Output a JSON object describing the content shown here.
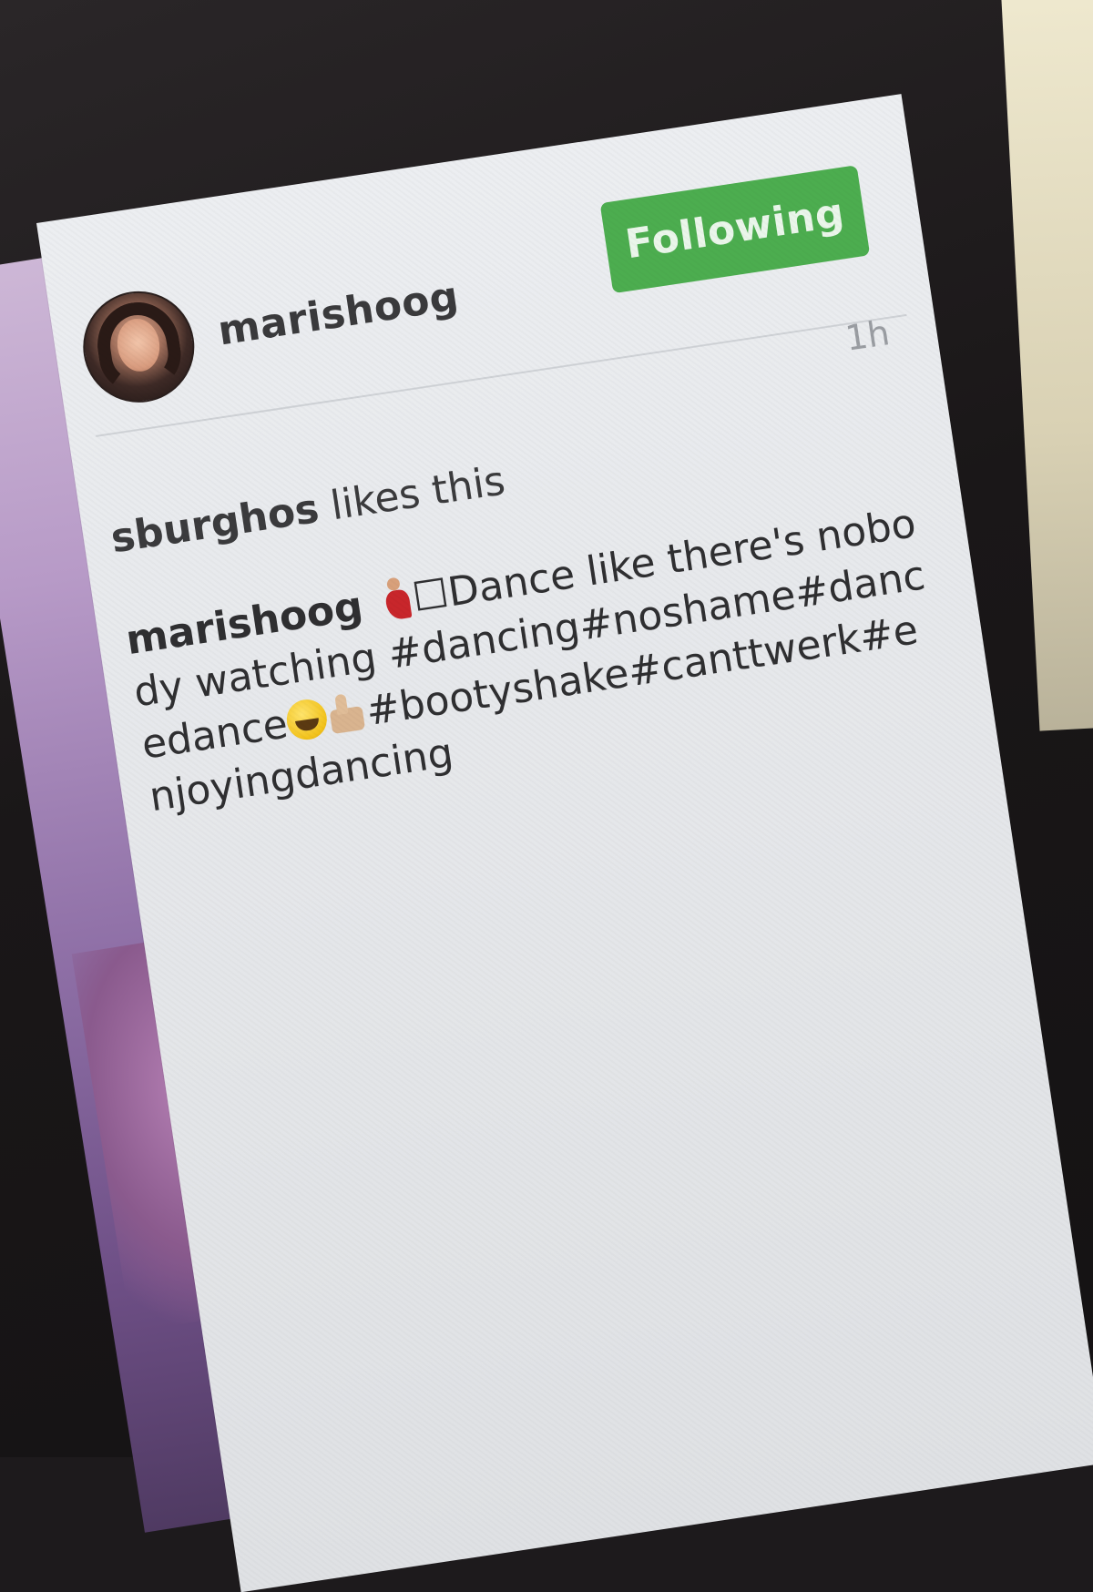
{
  "post": {
    "username": "marishoog",
    "follow_button_label": "Following",
    "timestamp": "1h",
    "likes": {
      "liker": "sburghos",
      "suffix": " likes this"
    },
    "caption": {
      "author": "marishoog",
      "text_part1": "Dance like there's nobody watching #dancing#noshame#dancedance",
      "text_part2": "#bootyshake#canttwerk#enjoyingdancing",
      "box_glyph": "☐"
    }
  },
  "icons": {
    "avatar": "profile-photo",
    "dancer": "dancer-emoji",
    "smile": "grinning-face-emoji",
    "thumb": "thumbs-up-emoji"
  },
  "colors": {
    "follow_button": "#4cad4f",
    "panel_background": "#eceef1",
    "text": "#2f2f31",
    "timestamp": "#9a9da2"
  }
}
